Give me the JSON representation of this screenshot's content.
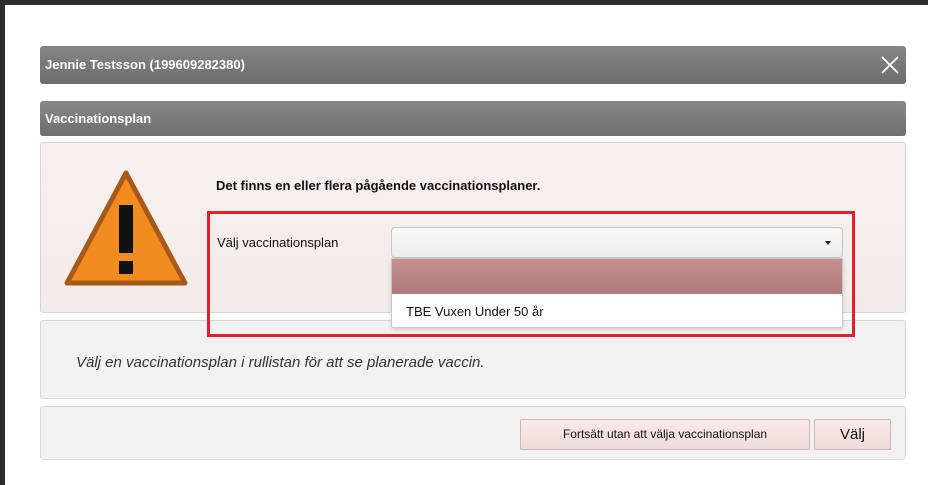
{
  "dialog": {
    "title": "Jennie Testsson (199609282380)",
    "close_icon": "close-icon"
  },
  "section": {
    "title": "Vaccinationsplan"
  },
  "warning": {
    "icon": "warning-icon",
    "message": "Det finns en eller flera pågående vaccinationsplaner."
  },
  "plan_select": {
    "label": "Välj vaccinationsplan",
    "value": "",
    "options": [
      "",
      "TBE Vuxen Under 50 år"
    ]
  },
  "info": {
    "text": "Välj en vaccinationsplan i rullistan för att se planerade vaccin."
  },
  "buttons": {
    "continue_label": "Fortsätt utan att välja vaccinationsplan",
    "select_label": "Välj"
  },
  "colors": {
    "header_gray": "#7a7a7a",
    "warning_orange": "#f28c1e",
    "highlight_red": "#e0202c",
    "selected_option": "#b98484"
  }
}
